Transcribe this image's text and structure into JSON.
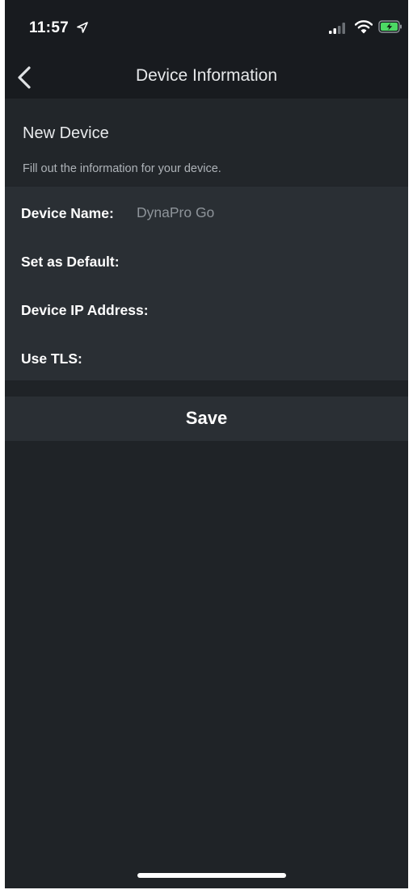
{
  "status_bar": {
    "time": "11:57",
    "icons": [
      "location-arrow-icon",
      "cellular-signal-icon",
      "wifi-icon",
      "battery-charging-icon"
    ]
  },
  "nav": {
    "back_icon": "chevron-left-icon",
    "title": "Device Information"
  },
  "header": {
    "title": "New Device",
    "subtitle": "Fill out the information for your device."
  },
  "form": {
    "device_name": {
      "label": "Device Name:",
      "placeholder": "DynaPro Go",
      "value": ""
    },
    "set_as_default": {
      "label": "Set as Default:"
    },
    "device_ip": {
      "label": "Device IP Address:",
      "value": ""
    },
    "use_tls": {
      "label": "Use TLS:"
    }
  },
  "actions": {
    "save_label": "Save"
  },
  "colors": {
    "background": "#1f2327",
    "bar": "#181b1f",
    "header": "#22262a",
    "form": "#2a2f34",
    "text": "#ffffff",
    "muted": "#8e949a",
    "battery_charging": "#4cd964"
  }
}
